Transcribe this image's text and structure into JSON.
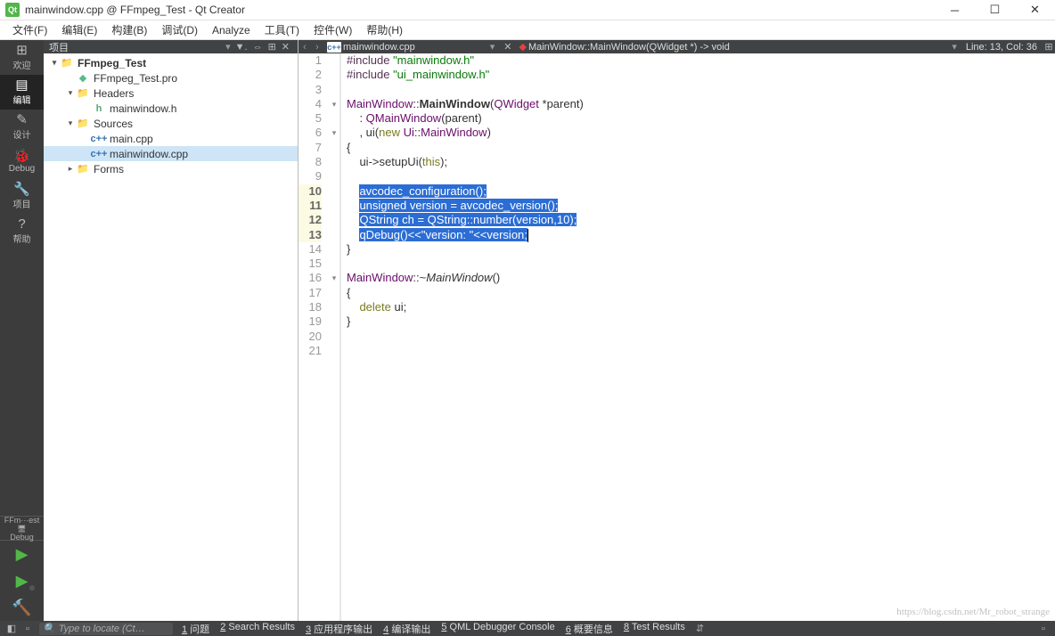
{
  "title": "mainwindow.cpp @ FFmpeg_Test - Qt Creator",
  "menu": [
    "文件(F)",
    "编辑(E)",
    "构建(B)",
    "调试(D)",
    "Analyze",
    "工具(T)",
    "控件(W)",
    "帮助(H)"
  ],
  "sidebar": {
    "items": [
      {
        "icon": "⊞",
        "label": "欢迎"
      },
      {
        "icon": "▤",
        "label": "编辑"
      },
      {
        "icon": "✎",
        "label": "设计"
      },
      {
        "icon": "🐞",
        "label": "Debug"
      },
      {
        "icon": "🔧",
        "label": "项目"
      },
      {
        "icon": "?",
        "label": "帮助"
      }
    ],
    "active": 1,
    "kit_top": "FFm···est",
    "kit_bot": "Debug"
  },
  "project_panel": {
    "header": "项目",
    "tree": [
      {
        "depth": 0,
        "tw": "▾",
        "icon": "proj",
        "label": "FFmpeg_Test",
        "bold": true
      },
      {
        "depth": 1,
        "tw": "",
        "icon": "pro",
        "label": "FFmpeg_Test.pro"
      },
      {
        "depth": 1,
        "tw": "▾",
        "icon": "folder",
        "label": "Headers"
      },
      {
        "depth": 2,
        "tw": "",
        "icon": "h",
        "label": "mainwindow.h"
      },
      {
        "depth": 1,
        "tw": "▾",
        "icon": "folder",
        "label": "Sources"
      },
      {
        "depth": 2,
        "tw": "",
        "icon": "cpp",
        "label": "main.cpp"
      },
      {
        "depth": 2,
        "tw": "",
        "icon": "cpp",
        "label": "mainwindow.cpp",
        "sel": true
      },
      {
        "depth": 1,
        "tw": "▸",
        "icon": "folder",
        "label": "Forms"
      }
    ]
  },
  "editor_header": {
    "filename": "mainwindow.cpp",
    "symbol": "MainWindow::MainWindow(QWidget *) -> void",
    "position": "Line: 13, Col: 36"
  },
  "code": {
    "lines": [
      {
        "n": 1,
        "html": "<span class='pp'>#include</span> <span class='str'>\"mainwindow.h\"</span>"
      },
      {
        "n": 2,
        "html": "<span class='pp'>#include</span> <span class='str'>\"ui_mainwindow.h\"</span>"
      },
      {
        "n": 3,
        "html": ""
      },
      {
        "n": 4,
        "fold": "▾",
        "html": "<span class='type2'>MainWindow</span>::<span class='bold2'>MainWindow</span>(<span class='type2'>QWidget</span> *parent)"
      },
      {
        "n": 5,
        "html": "    : <span class='type2'>QMainWindow</span>(parent)"
      },
      {
        "n": 6,
        "fold": "▾",
        "html": "    , <span class='ident'>ui</span>(<span class='kw'>new</span> <span class='type2'>Ui</span>::<span class='type2'>MainWindow</span>)"
      },
      {
        "n": 7,
        "html": "{"
      },
      {
        "n": 8,
        "html": "    <span class='ident'>ui</span>-&gt;setupUi(<span class='kw'>this</span>);"
      },
      {
        "n": 9,
        "html": ""
      },
      {
        "n": 10,
        "cur": true,
        "html": "    <span class='sel-bg'>avcodec_configuration();</span>"
      },
      {
        "n": 11,
        "cur": true,
        "html": "    <span class='sel-bg'>unsigned version = avcodec_version();</span>"
      },
      {
        "n": 12,
        "cur": true,
        "html": "    <span class='sel-bg'>QString ch = QString::number(version,10);</span>"
      },
      {
        "n": 13,
        "cur": true,
        "html": "    <span class='sel-bg'>qDebug()&lt;&lt;\"version: \"&lt;&lt;version;</span><span class='cursor'></span>"
      },
      {
        "n": 14,
        "html": "}"
      },
      {
        "n": 15,
        "html": ""
      },
      {
        "n": 16,
        "fold": "▾",
        "html": "<span class='type2'>MainWindow</span>::~<span class='italic'>MainWindow</span>()"
      },
      {
        "n": 17,
        "html": "{"
      },
      {
        "n": 18,
        "html": "    <span class='kw'>delete</span> <span class='ident'>ui</span>;"
      },
      {
        "n": 19,
        "html": "}"
      },
      {
        "n": 20,
        "html": ""
      },
      {
        "n": 21,
        "html": ""
      }
    ]
  },
  "statusbar": {
    "locate_placeholder": "Type to locate (Ct…",
    "outputs": [
      {
        "n": "1",
        "label": "问题"
      },
      {
        "n": "2",
        "label": "Search Results"
      },
      {
        "n": "3",
        "label": "应用程序输出"
      },
      {
        "n": "4",
        "label": "编译输出"
      },
      {
        "n": "5",
        "label": "QML Debugger Console"
      },
      {
        "n": "6",
        "label": "概要信息"
      },
      {
        "n": "8",
        "label": "Test Results"
      }
    ]
  },
  "watermark": "https://blog.csdn.net/Mr_robot_strange"
}
